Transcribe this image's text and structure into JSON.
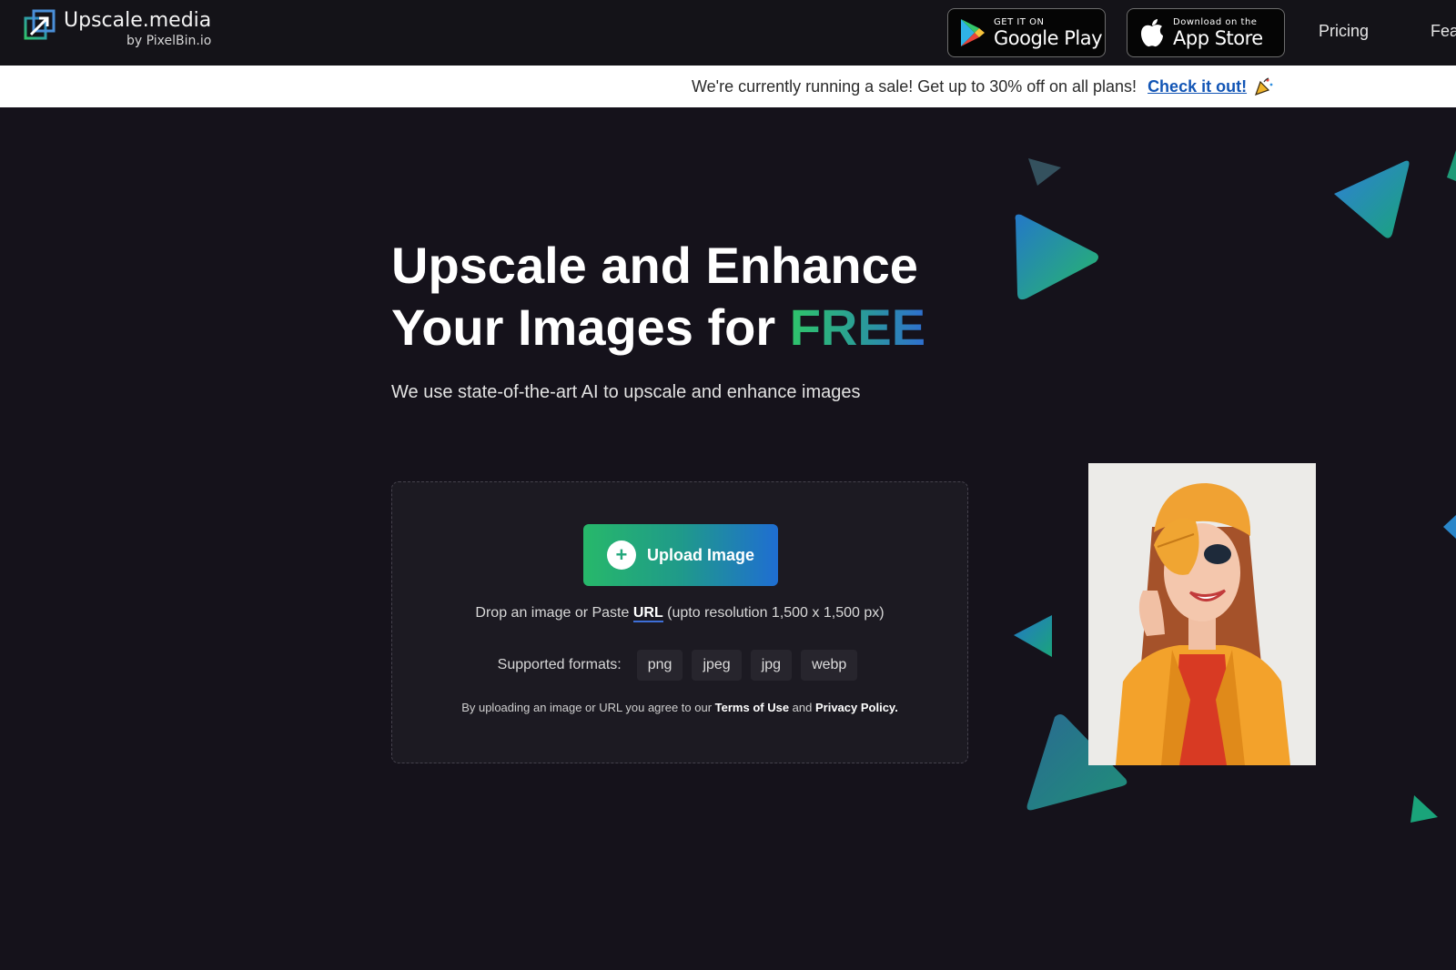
{
  "header": {
    "logo_name": "Upscale.media",
    "logo_sub": "by PixelBin.io",
    "google_play": {
      "small": "GET IT ON",
      "big": "Google Play"
    },
    "app_store": {
      "small": "Download on the",
      "big": "App Store"
    },
    "nav": [
      "Pricing",
      "Fea"
    ]
  },
  "banner": {
    "text": "We're currently running a sale! Get up to 30% off on all plans!",
    "link": "Check it out!"
  },
  "hero": {
    "title_line1": "Upscale and Enhance",
    "title_line2": "Your Images for ",
    "title_highlight": "FREE",
    "subtitle": "We use state-of-the-art AI to upscale and enhance images"
  },
  "upload": {
    "button_label": "Upload Image",
    "drop_prefix": "Drop an image or Paste ",
    "drop_link": "URL",
    "drop_suffix": " (upto resolution 1,500 x 1,500 px)",
    "formats_label": "Supported formats:",
    "formats": [
      "png",
      "jpeg",
      "jpg",
      "webp"
    ],
    "legal_prefix": "By uploading an image or URL you agree to our ",
    "terms": "Terms of Use",
    "legal_and": " and ",
    "privacy": "Privacy Policy."
  },
  "colors": {
    "page_bg": "#15121b",
    "accent_green": "#27b86a",
    "accent_blue": "#1f6ed2",
    "link_blue": "#1255b5"
  },
  "icons": {
    "logo": "upscale-arrow-icon",
    "google_play": "google-play-icon",
    "app_store": "apple-icon",
    "banner": "party-popper-icon",
    "upload": "plus-icon"
  }
}
